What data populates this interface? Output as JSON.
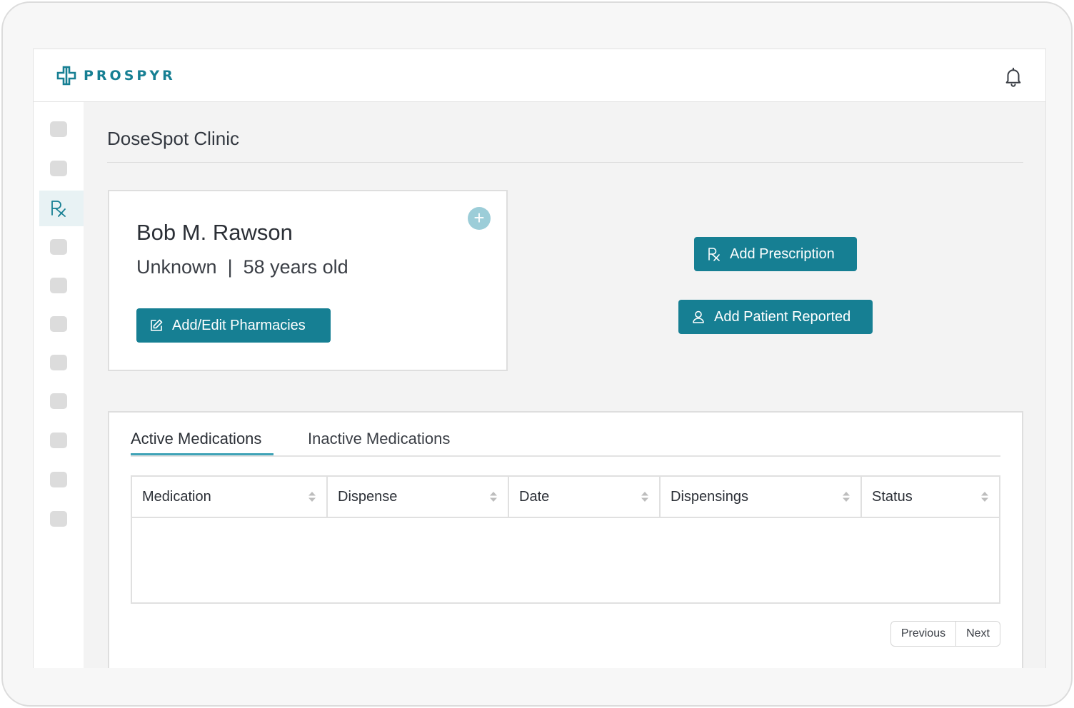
{
  "app": {
    "brand": "PROSPYR",
    "accent_color": "#167f93",
    "icons": {
      "logo": "medical-cross-logo-icon",
      "notifications": "bell-icon",
      "rx": "rx-icon"
    }
  },
  "page": {
    "title": "DoseSpot Clinic"
  },
  "patient": {
    "name": "Bob M. Rawson",
    "gender": "Unknown",
    "separator": "|",
    "age": "58 years old"
  },
  "actions": {
    "pharmacies_label": "Add/Edit Pharmacies",
    "prescription_label": "Add Prescription",
    "patient_reported_label": "Add Patient Reported"
  },
  "medications": {
    "tabs": [
      {
        "label": "Active Medications",
        "active": true
      },
      {
        "label": "Inactive Medications",
        "active": false
      }
    ],
    "columns": [
      "Medication",
      "Dispense",
      "Date",
      "Dispensings",
      "Status"
    ],
    "rows": [],
    "pagination": {
      "previous": "Previous",
      "next": "Next"
    }
  }
}
